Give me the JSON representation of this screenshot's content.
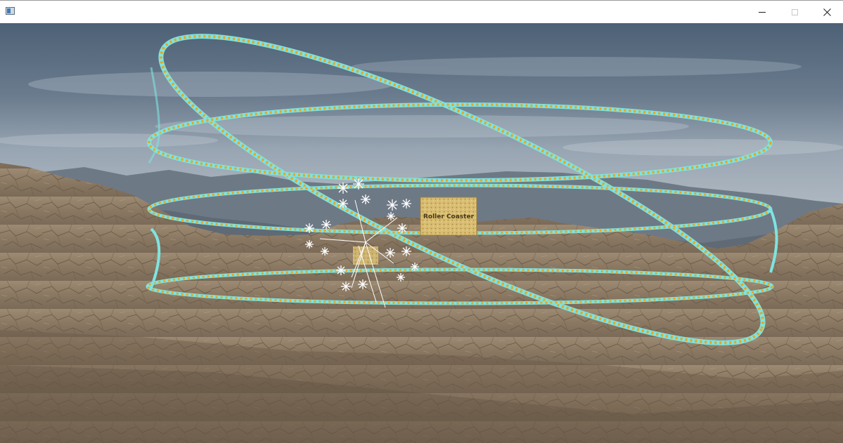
{
  "window": {
    "title": "",
    "controls": {
      "minimize": "minimize",
      "maximize": "maximize",
      "close": "close"
    }
  },
  "scene": {
    "sign_text": "Roller Coaster",
    "colors": {
      "sky_top": "#4f6378",
      "sky_bottom": "#a9b4bf",
      "mountains": "#6c7784",
      "ground": "#8c7b66",
      "track_rail": "#7fe3e0",
      "track_tie": "#e2a825",
      "sign": "#d4b86a"
    }
  }
}
